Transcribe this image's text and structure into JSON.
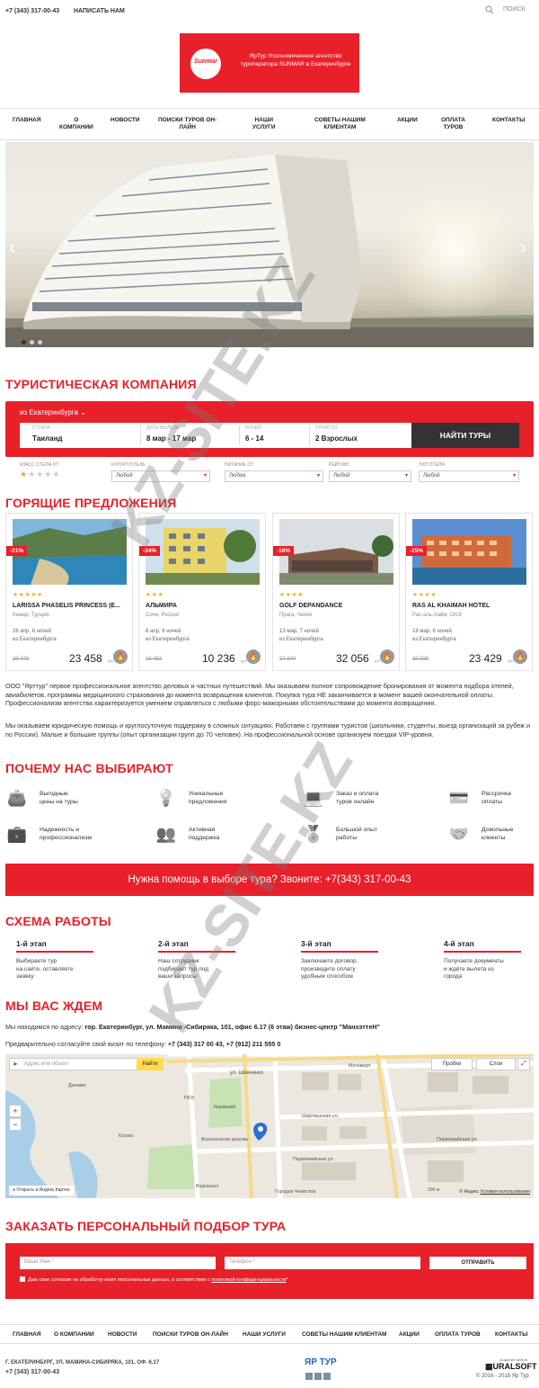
{
  "topbar": {
    "phone": "+7 (343) 317-00-43",
    "write_us": "НАПИСАТЬ НАМ",
    "search": "ПОИСК"
  },
  "logo": {
    "brand": "Sunmar",
    "text": "ЯрТур Уполномоченное агентство туроператора SUNMAR в Екатеринбурге"
  },
  "nav": [
    "ГЛАВНАЯ",
    "О КОМПАНИИ",
    "НОВОСТИ",
    "ПОИСКИ ТУРОВ ОН-ЛАЙН",
    "НАШИ УСЛУГИ",
    "СОВЕТЫ НАШИМ КЛИЕНТАМ",
    "АКЦИИ",
    "ОПЛАТА ТУРОВ",
    "КОНТАКТЫ"
  ],
  "nav_lines": [
    [
      "ГЛАВНАЯ"
    ],
    [
      "О",
      "КОМПАНИИ"
    ],
    [
      "НОВОСТИ"
    ],
    [
      "ПОИСКИ ТУРОВ ОН-",
      "ЛАЙН"
    ],
    [
      "НАШИ",
      "УСЛУГИ"
    ],
    [
      "СОВЕТЫ НАШИМ",
      "КЛИЕНТАМ"
    ],
    [
      "АКЦИИ"
    ],
    [
      "ОПЛАТА",
      "ТУРОВ"
    ],
    [
      "КОНТАКТЫ"
    ]
  ],
  "headings": {
    "company": "ТУРИСТИЧЕСКАЯ КОМПАНИЯ",
    "hot": "ГОРЯЩИЕ ПРЕДЛОЖЕНИЯ",
    "why": "ПОЧЕМУ НАС ВЫБИРАЮТ",
    "scheme": "СХЕМА РАБОТЫ",
    "wait": "МЫ ВАС ЖДЕМ",
    "order": "ЗАКАЗАТЬ ПЕРСОНАЛЬНЫЙ ПОДБОР ТУРА"
  },
  "search": {
    "from": "из Екатеринбурга",
    "fields": [
      {
        "label": "СТРАНА",
        "value": "Таиланд"
      },
      {
        "label": "ДАТЫ ВЫЛЕТА",
        "value": "8 мар - 17 мар"
      },
      {
        "label": "НОЧЕЙ",
        "value": "6 - 14"
      },
      {
        "label": "ТУРИСТЫ",
        "value": "2 Взрослых"
      }
    ],
    "button": "НАЙТИ ТУРЫ"
  },
  "filters": [
    {
      "label": "КЛАСС ОТЕЛЯ ОТ",
      "value": ""
    },
    {
      "label": "КУРОРТ/ОТЕЛЬ",
      "value": "Любой"
    },
    {
      "label": "ПИТАНИЕ ОТ",
      "value": "Любое"
    },
    {
      "label": "РЕЙТИНГ",
      "value": "Любой"
    },
    {
      "label": "ТИП ОТЕЛЯ",
      "value": "Любой"
    }
  ],
  "hotel_class_stars": 1,
  "offers": [
    {
      "discount": "-21%",
      "stars": 5,
      "name": "LARISSA PHASELIS PRINCESS (E...",
      "location": "Кемер, Турция",
      "duration": "26 апр, 6 ночей",
      "city": "из Екатеринбурга",
      "old_price": "29 476",
      "price": "23 458",
      "currency": "руб"
    },
    {
      "discount": "-34%",
      "stars": 3,
      "name": "АЛЬМИРА",
      "location": "Сочи, Россия",
      "duration": "6 апр, 6 ночей",
      "city": "из Екатеринбурга",
      "old_price": "15 452",
      "price": "10 236",
      "currency": "руб"
    },
    {
      "discount": "-16%",
      "stars": 4,
      "name": "GOLF DEPANDANCE",
      "location": "Прага, Чехия",
      "duration": "13 мар, 7 ночей",
      "city": "из Екатеринбурга",
      "old_price": "37 940",
      "price": "32 056",
      "currency": "руб"
    },
    {
      "discount": "-25%",
      "stars": 4,
      "name": "RAS AL KHAIMAH HOTEL",
      "location": "Рас-эль-Хайм, ОАЭ",
      "duration": "18 мар, 6 ночей",
      "city": "из Екатеринбурга",
      "old_price": "30 929",
      "price": "23 429",
      "currency": "руб"
    }
  ],
  "about": [
    "ООО \"Ярттур\" первое профессиональное агентство деловых и частных путешествий. Мы оказываем полное сопровождение бронирования от момента подбора отелей, авиабилетов, программы медицинского страхования до момента возвращения клиентов. Покупка тура НЕ заканчивается в момент вашей окончательной оплаты. Профессионализм агентства характеризуется умением справляться с любыми форс-мажорными обстоятельствами до момента возвращения.",
    "Мы оказываем юридическую помощь и круглосуточную поддержку в сложных ситуациях. Работаем с группами туристов (школьники, студенты, выезд организаций за рубеж и по России). Малые и большие группы (опыт организации групп до 70 человек). На профессиональной основе организуем поездки VIP-уровня."
  ],
  "why": [
    {
      "icon": "wallet-icon",
      "lines": [
        "Выгодные",
        "цены на туры"
      ]
    },
    {
      "icon": "lightbulb-icon",
      "lines": [
        "Уникальные",
        "предложения"
      ]
    },
    {
      "icon": "laptop-icon",
      "lines": [
        "Заказ и оплата",
        "туров онлайн"
      ]
    },
    {
      "icon": "payment-icon",
      "lines": [
        "Рассрочка",
        "оплаты"
      ]
    },
    {
      "icon": "briefcase-icon",
      "lines": [
        "Надежность и",
        "профессионализм"
      ]
    },
    {
      "icon": "team-icon",
      "lines": [
        "Активная",
        "поддержка"
      ]
    },
    {
      "icon": "medal-icon",
      "lines": [
        "Большой опыт",
        "работы"
      ]
    },
    {
      "icon": "handshake-icon",
      "lines": [
        "Довольные",
        "клиенты"
      ]
    }
  ],
  "banner": "Нужна помощь в выборе тура? Звоните: +7(343) 317-00-43",
  "steps": [
    {
      "title": "1-й этап",
      "lines": [
        "Выбираете тур",
        "на сайте, оставляете",
        "заявку"
      ]
    },
    {
      "title": "2-й этап",
      "lines": [
        "Наш сотрудник",
        "подбирает тур под",
        "ваши запросы"
      ]
    },
    {
      "title": "3-й этап",
      "lines": [
        "Заключаете договор,",
        "производите оплату",
        "удобным способом"
      ]
    },
    {
      "title": "4-й этап",
      "lines": [
        "Получаете документы",
        "и ждёте вылета из",
        "города"
      ]
    }
  ],
  "address": {
    "label": "Мы находимся по адресу:",
    "value": "гор. Екатеринбург, ул. Мамина -Сибиряка, 101, офис 6.17 (6 этаж) бизнес-центр \"МанхэттеН\"",
    "phone_label": "Предварительно согласуйте свой визит по телефону:",
    "phone_value": "+7 (343) 317 00 43, +7 (912) 211 555 0"
  },
  "map": {
    "search_placeholder": "Адрес или объект",
    "find": "Найти",
    "traffic": "Пробки",
    "layers": "Слои",
    "open_link": "Открыть в Яндекс.Картах",
    "copyright": "© Яндекс",
    "terms": "Условия использования",
    "zoom_in": "+",
    "zoom_out": "−",
    "labels": [
      "ул. Шевченко",
      "Мегамарт",
      "ТЮЗ",
      "Вознесенская церковь",
      "ул. Карла Либкнехта",
      "Городок Чекистов",
      "Первомайская ул.",
      "ул. Луначарского",
      "ул. Мичурина",
      "Восточная ул.",
      "Шарташская ул.",
      "Первомайская ул.",
      "ул. Гоголя",
      "Кировский",
      "Динамо",
      "Космос",
      "Водоканал",
      "200 м",
      "Пробки"
    ]
  },
  "form": {
    "name_placeholder": "Ваше Имя *",
    "phone_placeholder": "Телефон *",
    "send": "ОТПРАВИТЬ",
    "agree_text": "Даю свое согласие на обработку моих персональных данных, в соответствии с",
    "agree_link": "политикой конфиденциальности",
    "agree_star": "*"
  },
  "footer_nav": [
    "ГЛАВНАЯ",
    "О КОМПАНИИ",
    "НОВОСТИ",
    "ПОИСКИ ТУРОВ ОН-ЛАЙН",
    "НАШИ УСЛУГИ",
    "СОВЕТЫ НАШИМ КЛИЕНТАМ",
    "АКЦИИ",
    "ОПЛАТА ТУРОВ",
    "КОНТАКТЫ"
  ],
  "footer": {
    "address": "Г. ЕКАТЕРИНБУРГ, УЛ. МАМИНА-СИБИРЯКА, 101, ОФ. 6.17",
    "phone": "+7 (343) 317-00-43",
    "brand": "ЯР ТУР",
    "dev_label": "создание сайтов",
    "dev": "URALSOFT",
    "copyright": "© 2016 - 2018 Яр Тур"
  },
  "watermark": "KZ-SITE.KZ",
  "colors": {
    "accent": "#e8202a",
    "dark": "#333333"
  }
}
